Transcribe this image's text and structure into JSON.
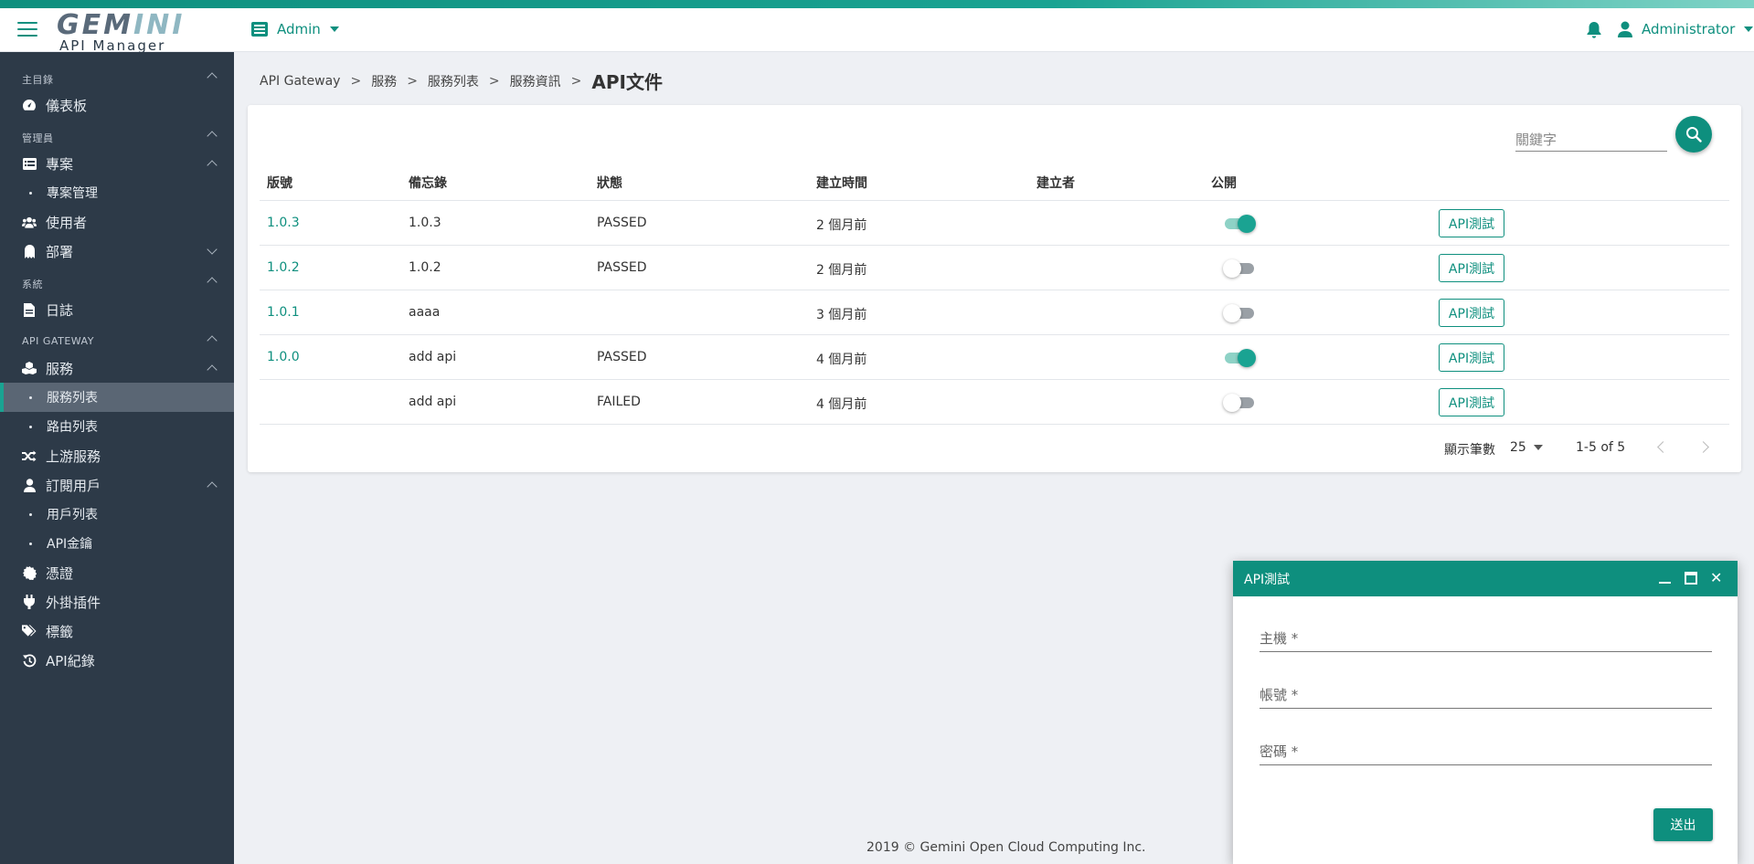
{
  "header": {
    "logo_main_a": "GEM",
    "logo_main_b": "INI",
    "logo_sub": "API Manager",
    "admin_label": "Admin",
    "user_label": "Administrator"
  },
  "sidebar": {
    "section_main": "主目錄",
    "dashboard": "儀表板",
    "section_admin": "管理員",
    "projects": "專案",
    "project_mgmt": "專案管理",
    "users": "使用者",
    "departments": "部署",
    "section_system": "系統",
    "logs": "日誌",
    "section_gateway": "API GATEWAY",
    "services": "服務",
    "service_list": "服務列表",
    "route_list": "路由列表",
    "upstream": "上游服務",
    "subscribers": "訂閱用戶",
    "user_list": "用戶列表",
    "api_keys": "API金鑰",
    "certificates": "憑證",
    "plugins": "外掛插件",
    "tags": "標籤",
    "api_records": "API紀錄"
  },
  "breadcrumb": {
    "items": [
      "API Gateway",
      "服務",
      "服務列表",
      "服務資訊"
    ],
    "separator": ">",
    "current": "API文件"
  },
  "search": {
    "placeholder": "關鍵字"
  },
  "table": {
    "headers": [
      "版號",
      "備忘錄",
      "狀態",
      "建立時間",
      "建立者",
      "公開"
    ],
    "action_label": "API測試",
    "rows": [
      {
        "version": "1.0.3",
        "memo": "1.0.3",
        "status": "PASSED",
        "created": "2 個月前",
        "creator": "",
        "public": true
      },
      {
        "version": "1.0.2",
        "memo": "1.0.2",
        "status": "PASSED",
        "created": "2 個月前",
        "creator": "",
        "public": false
      },
      {
        "version": "1.0.1",
        "memo": "aaaa",
        "status": "",
        "created": "3 個月前",
        "creator": "",
        "public": false
      },
      {
        "version": "1.0.0",
        "memo": "add api",
        "status": "PASSED",
        "created": "4 個月前",
        "creator": "",
        "public": true
      },
      {
        "version": "",
        "memo": "add api",
        "status": "FAILED",
        "created": "4 個月前",
        "creator": "",
        "public": false
      }
    ]
  },
  "pagination": {
    "rows_label": "顯示筆數",
    "rows_value": "25",
    "range": "1-5 of 5"
  },
  "footer": {
    "text": "2019 © Gemini Open Cloud Computing Inc."
  },
  "dialog": {
    "title": "API測試",
    "host_placeholder": "主機 *",
    "account_placeholder": "帳號 *",
    "password_placeholder": "密碼 *",
    "submit_label": "送出"
  },
  "colors": {
    "accent": "#0e8f7e",
    "sidebar": "#2d3a48",
    "background": "#eef0f4"
  }
}
